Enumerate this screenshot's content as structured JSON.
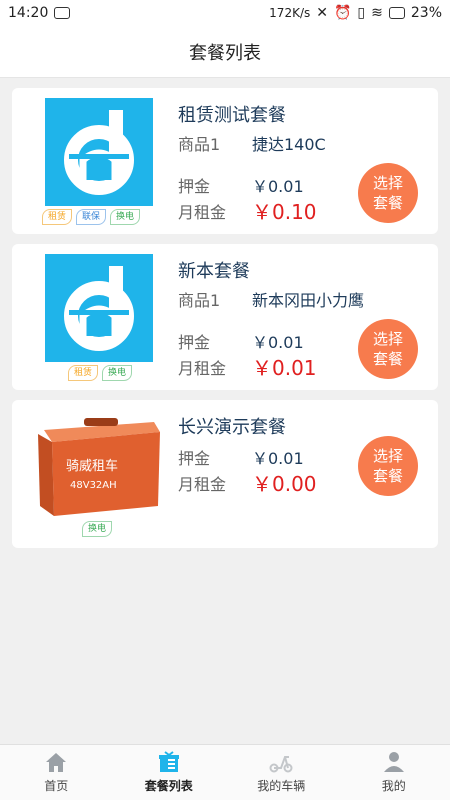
{
  "status_bar": {
    "time": "14:20",
    "speed": "172K/s",
    "battery": "23%",
    "network": "4G"
  },
  "header": {
    "title": "套餐列表"
  },
  "packages": [
    {
      "name": "租赁测试套餐",
      "product_label": "商品1",
      "product_name": "捷达140C",
      "deposit_label": "押金",
      "deposit": "￥0.01",
      "rent_label": "月租金",
      "rent": "￥0.10",
      "tags": [
        "租赁",
        "联保",
        "换电"
      ],
      "button": "选择套餐",
      "image": "logo-icon"
    },
    {
      "name": "新本套餐",
      "product_label": "商品1",
      "product_name": "新本冈田小力鹰",
      "deposit_label": "押金",
      "deposit": "￥0.01",
      "rent_label": "月租金",
      "rent": "￥0.01",
      "tags": [
        "租赁",
        "换电"
      ],
      "button": "选择套餐",
      "image": "logo-icon"
    },
    {
      "name": "长兴演示套餐",
      "deposit_label": "押金",
      "deposit": "￥0.01",
      "rent_label": "月租金",
      "rent": "￥0.00",
      "tags": [
        "换电"
      ],
      "button": "选择套餐",
      "image": "battery-box-image",
      "battery_text_1": "骑威租车",
      "battery_text_2": "48V32AH"
    }
  ],
  "tabbar": [
    {
      "label": "首页",
      "icon": "home-icon"
    },
    {
      "label": "套餐列表",
      "icon": "gift-list-icon",
      "active": true
    },
    {
      "label": "我的车辆",
      "icon": "scooter-icon"
    },
    {
      "label": "我的",
      "icon": "person-icon"
    }
  ],
  "colors": {
    "accent": "#f77b4d",
    "price_red": "#e02020",
    "logo_blue": "#1fb4ea",
    "battery_orange": "#e0602f"
  }
}
